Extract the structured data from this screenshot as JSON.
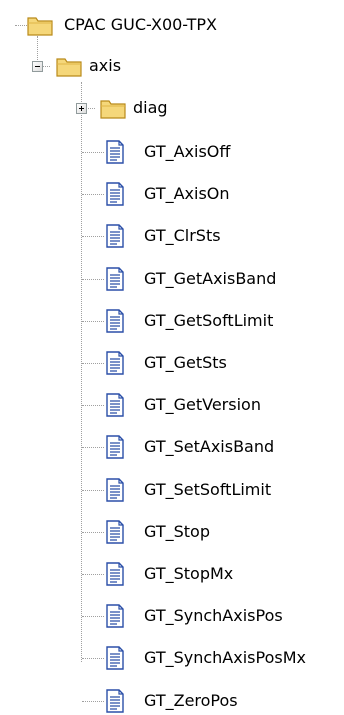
{
  "tree": {
    "root": {
      "label": "CPAC GUC-X00-TPX",
      "icon": "folder-icon"
    },
    "axis": {
      "label": "axis",
      "icon": "folder-open-icon",
      "expanded": true
    },
    "diag": {
      "label": "diag",
      "icon": "folder-icon",
      "expanded": false
    },
    "files": [
      {
        "label": "GT_AxisOff",
        "icon": "document-icon"
      },
      {
        "label": "GT_AxisOn",
        "icon": "document-icon"
      },
      {
        "label": "GT_ClrSts",
        "icon": "document-icon"
      },
      {
        "label": "GT_GetAxisBand",
        "icon": "document-icon"
      },
      {
        "label": "GT_GetSoftLimit",
        "icon": "document-icon"
      },
      {
        "label": "GT_GetSts",
        "icon": "document-icon"
      },
      {
        "label": "GT_GetVersion",
        "icon": "document-icon"
      },
      {
        "label": "GT_SetAxisBand",
        "icon": "document-icon"
      },
      {
        "label": "GT_SetSoftLimit",
        "icon": "document-icon"
      },
      {
        "label": "GT_Stop",
        "icon": "document-icon"
      },
      {
        "label": "GT_StopMx",
        "icon": "document-icon"
      },
      {
        "label": "GT_SynchAxisPos",
        "icon": "document-icon"
      },
      {
        "label": "GT_SynchAxisPosMx",
        "icon": "document-icon"
      },
      {
        "label": "GT_ZeroPos",
        "icon": "document-icon"
      }
    ]
  },
  "colors": {
    "folder_fill": "#f5d77a",
    "folder_stroke": "#b98a1a",
    "doc_stroke": "#2b4fa8",
    "tree_line": "#a0a0a0"
  }
}
